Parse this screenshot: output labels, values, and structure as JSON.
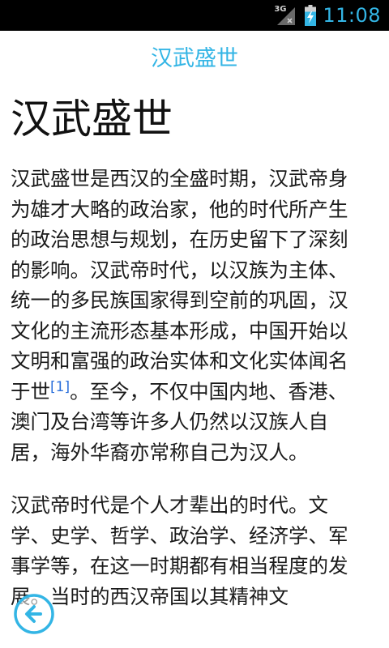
{
  "status_bar": {
    "network_label": "3G",
    "time": "11:08",
    "icons": [
      "signal-icon",
      "battery-charging-icon"
    ]
  },
  "header": {
    "title": "汉武盛世"
  },
  "article": {
    "heading": "汉武盛世",
    "paragraph1_part1": "汉武盛世是西汉的全盛时期，汉武帝身为雄才大略的政治家，他的时代所产生的政治思想与规划，在历史留下了深刻的影响。汉武帝时代，以汉族为主体、统一的多民族国家得到空前的巩固，汉文化的主流形态基本形成，中国开始以文明和富强的政治实体和文化实体闻名于世",
    "citation": "[1]",
    "paragraph1_part2": "。至今，不仅中国内地、香港、澳门及台湾等许多人仍然以汉族人自居，海外华裔亦常称自己为汉人。",
    "paragraph2": "汉武帝时代是个人才辈出的时代。文学、史学、哲学、政治学、经济学、军事学等，在这一时期都有相当程度的发展。当时的西汉帝国以其精神文"
  },
  "colors": {
    "accent": "#33b5e5",
    "link": "#2a6fdb",
    "status_bar_bg": "#000000"
  },
  "back_button": {
    "icon": "back-arrow-icon"
  }
}
